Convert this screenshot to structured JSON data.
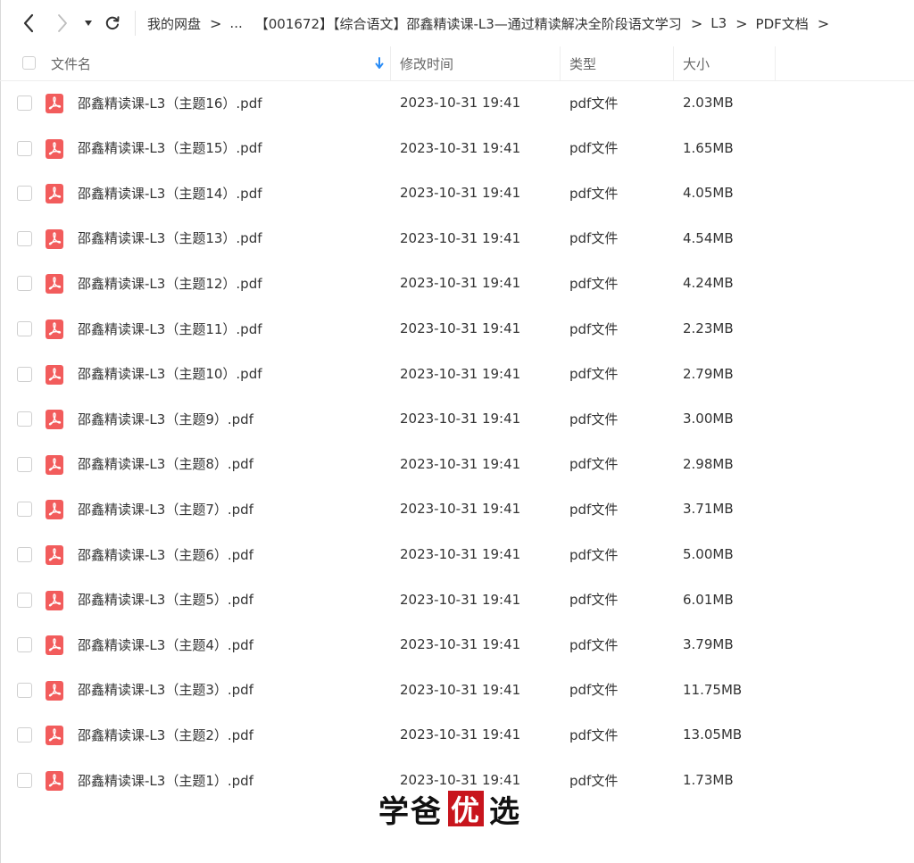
{
  "navbar": {
    "back_icon": "chevron-left-icon",
    "forward_icon": "chevron-right-icon",
    "dropdown_icon": "caret-down-icon",
    "refresh_icon": "refresh-icon",
    "breadcrumb": [
      "我的网盘",
      "...",
      "【001672】【综合语文】邵鑫精读课-L3—通过精读解决全阶段语文学习",
      "L3",
      "PDF文档"
    ],
    "separator": ">"
  },
  "header": {
    "name": "文件名",
    "modified": "修改时间",
    "type": "类型",
    "size": "大小",
    "sort_icon": "sort-down-arrow-icon"
  },
  "files": [
    {
      "name": "邵鑫精读课-L3（主题16）.pdf",
      "modified": "2023-10-31 19:41",
      "type": "pdf文件",
      "size": "2.03MB"
    },
    {
      "name": "邵鑫精读课-L3（主题15）.pdf",
      "modified": "2023-10-31 19:41",
      "type": "pdf文件",
      "size": "1.65MB"
    },
    {
      "name": "邵鑫精读课-L3（主题14）.pdf",
      "modified": "2023-10-31 19:41",
      "type": "pdf文件",
      "size": "4.05MB"
    },
    {
      "name": "邵鑫精读课-L3（主题13）.pdf",
      "modified": "2023-10-31 19:41",
      "type": "pdf文件",
      "size": "4.54MB"
    },
    {
      "name": "邵鑫精读课-L3（主题12）.pdf",
      "modified": "2023-10-31 19:41",
      "type": "pdf文件",
      "size": "4.24MB"
    },
    {
      "name": "邵鑫精读课-L3（主题11）.pdf",
      "modified": "2023-10-31 19:41",
      "type": "pdf文件",
      "size": "2.23MB"
    },
    {
      "name": "邵鑫精读课-L3（主题10）.pdf",
      "modified": "2023-10-31 19:41",
      "type": "pdf文件",
      "size": "2.79MB"
    },
    {
      "name": "邵鑫精读课-L3（主题9）.pdf",
      "modified": "2023-10-31 19:41",
      "type": "pdf文件",
      "size": "3.00MB"
    },
    {
      "name": "邵鑫精读课-L3（主题8）.pdf",
      "modified": "2023-10-31 19:41",
      "type": "pdf文件",
      "size": "2.98MB"
    },
    {
      "name": "邵鑫精读课-L3（主题7）.pdf",
      "modified": "2023-10-31 19:41",
      "type": "pdf文件",
      "size": "3.71MB"
    },
    {
      "name": "邵鑫精读课-L3（主题6）.pdf",
      "modified": "2023-10-31 19:41",
      "type": "pdf文件",
      "size": "5.00MB"
    },
    {
      "name": "邵鑫精读课-L3（主题5）.pdf",
      "modified": "2023-10-31 19:41",
      "type": "pdf文件",
      "size": "6.01MB"
    },
    {
      "name": "邵鑫精读课-L3（主题4）.pdf",
      "modified": "2023-10-31 19:41",
      "type": "pdf文件",
      "size": "3.79MB"
    },
    {
      "name": "邵鑫精读课-L3（主题3）.pdf",
      "modified": "2023-10-31 19:41",
      "type": "pdf文件",
      "size": "11.75MB"
    },
    {
      "name": "邵鑫精读课-L3（主题2）.pdf",
      "modified": "2023-10-31 19:41",
      "type": "pdf文件",
      "size": "13.05MB"
    },
    {
      "name": "邵鑫精读课-L3（主题1）.pdf",
      "modified": "2023-10-31 19:41",
      "type": "pdf文件",
      "size": "1.73MB"
    }
  ],
  "file_icon": "pdf-file-icon",
  "watermark": {
    "before": "学爸",
    "stamp": "优",
    "after": "选"
  },
  "colors": {
    "pdf_icon": "#f25c5c",
    "sort_arrow": "#2a8cf6",
    "watermark_stamp": "#c8151d"
  }
}
